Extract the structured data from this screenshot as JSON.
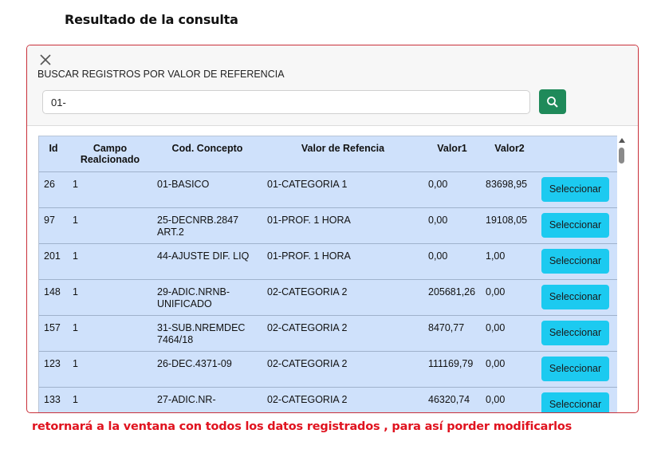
{
  "page": {
    "heading": "Resultado de la consulta"
  },
  "dialog": {
    "title": "BUSCAR REGISTROS POR VALOR DE REFERENCIA",
    "search_value": "01-",
    "close_icon": "close-icon",
    "search_icon": "search-icon"
  },
  "table": {
    "headers": [
      "Id",
      "Campo Realcionado",
      "Cod. Concepto",
      "Valor de Refencia",
      "Valor1",
      "Valor2",
      ""
    ],
    "rows": [
      {
        "id": "26",
        "campo": "1",
        "cod": "01-BASICO",
        "ref": "01-CATEGORIA 1",
        "v1": "0,00",
        "v2": "83698,95",
        "btn": "Seleccionar"
      },
      {
        "id": "97",
        "campo": "1",
        "cod": "25-DECNRB.2847 ART.2",
        "ref": "01-PROF. 1 HORA",
        "v1": "0,00",
        "v2": "19108,05",
        "btn": "Seleccionar"
      },
      {
        "id": "201",
        "campo": "1",
        "cod": "44-AJUSTE DIF. LIQ",
        "ref": "01-PROF. 1 HORA",
        "v1": "0,00",
        "v2": "1,00",
        "btn": "Seleccionar"
      },
      {
        "id": "148",
        "campo": "1",
        "cod": "29-ADIC.NRNB-UNIFICADO",
        "ref": "02-CATEGORIA 2",
        "v1": "205681,26",
        "v2": "0,00",
        "btn": "Seleccionar"
      },
      {
        "id": "157",
        "campo": "1",
        "cod": "31-SUB.NREMDEC 7464/18",
        "ref": "02-CATEGORIA 2",
        "v1": "8470,77",
        "v2": "0,00",
        "btn": "Seleccionar"
      },
      {
        "id": "123",
        "campo": "1",
        "cod": "26-DEC.4371-09",
        "ref": "02-CATEGORIA 2",
        "v1": "111169,79",
        "v2": "0,00",
        "btn": "Seleccionar"
      },
      {
        "id": "133",
        "campo": "1",
        "cod": "27-ADIC.NR-",
        "ref": "02-CATEGORIA 2",
        "v1": "46320,74",
        "v2": "0,00",
        "btn": "Seleccionar"
      }
    ]
  },
  "footer": {
    "note": "retornará a la ventana con todos los datos registrados , para así porder modificarlos"
  },
  "colors": {
    "accent_border": "#c9303a",
    "table_bg": "#cfe1fb",
    "select_button": "#1ccaf0",
    "search_button": "#1f8a5a",
    "note_text": "#e0131f"
  }
}
